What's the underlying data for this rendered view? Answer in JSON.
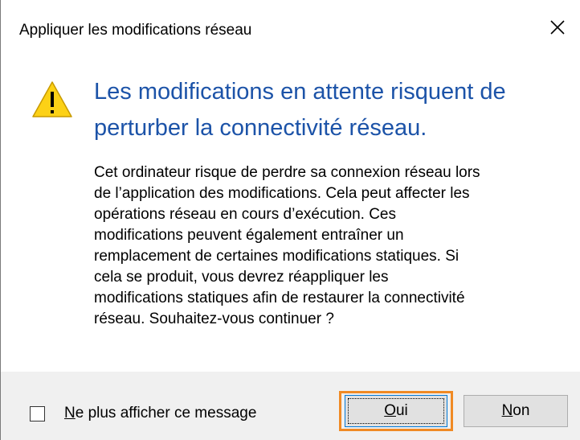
{
  "dialog": {
    "title": "Appliquer les modifications réseau",
    "close_icon": "close-icon",
    "warning_icon": "warning-icon",
    "heading_lines": [
      "Les modifications en attente risquent de",
      "perturber la connectivité réseau."
    ],
    "body_lines": [
      "Cet ordinateur risque de perdre sa connexion réseau lors",
      "de l’application des modifications. Cela peut affecter les",
      "opérations réseau en cours d’exécution. Ces",
      "modifications peuvent également entraîner un",
      "remplacement de certaines modifications statiques. Si",
      "cela se produit, vous devrez réappliquer les",
      "modifications statiques afin de restaurer la connectivité",
      "réseau. Souhaitez-vous continuer ?"
    ]
  },
  "footer": {
    "checkbox": {
      "label_mnemonic": "N",
      "label_rest": "e plus afficher ce message",
      "checked": false
    },
    "buttons": {
      "yes_mnemonic": "O",
      "yes_rest": "ui",
      "no_mnemonic": "N",
      "no_rest": "on"
    }
  },
  "colors": {
    "heading": "#1c53a8",
    "footer_bg": "#f0f0f0",
    "highlight": "#f08a24",
    "warning": "#fcd116"
  }
}
